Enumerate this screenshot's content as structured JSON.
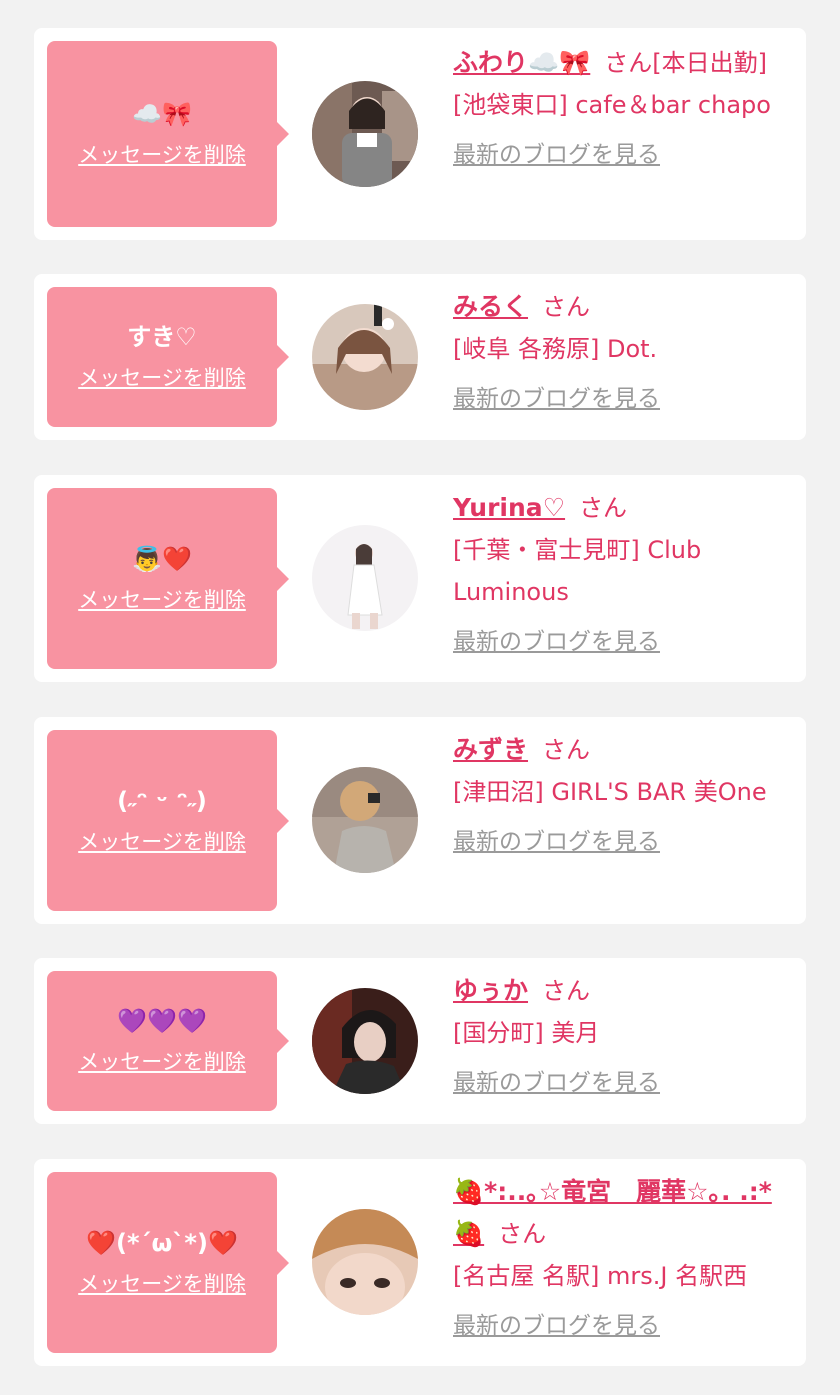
{
  "items": [
    {
      "message": "☁️🎀",
      "delete_label": "メッセージを削除",
      "name": "ふわり☁️🎀",
      "san": "さん",
      "status": "[本日出勤]",
      "shop": "[池袋東口] cafe＆bar chapo",
      "blog_label": "最新のブログを見る"
    },
    {
      "message": "すき♡",
      "delete_label": "メッセージを削除",
      "name": "みるく",
      "san": "さん",
      "shop": "[岐阜 各務原] Dot.",
      "blog_label": "最新のブログを見る"
    },
    {
      "message": "👼❤️",
      "delete_label": "メッセージを削除",
      "name": "Yurina♡",
      "san": "さん",
      "shop": "[千葉・富士見町] Club Luminous",
      "blog_label": "最新のブログを見る"
    },
    {
      "message": "(˶ᵔ ᵕ ᵔ˶)",
      "delete_label": "メッセージを削除",
      "name": "みずき",
      "san": "さん",
      "shop": "[津田沼] GIRL'S BAR 美One",
      "blog_label": "最新のブログを見る"
    },
    {
      "message": "💜💜💜",
      "delete_label": "メッセージを削除",
      "name": "ゆぅか",
      "san": "さん",
      "shop": "[国分町] 美月",
      "blog_label": "最新のブログを見る"
    },
    {
      "message": "❤️(*´ω`*)❤️",
      "delete_label": "メッセージを削除",
      "name": "🍓*:..｡☆竜宮　麗華☆｡. .:*🍓",
      "san": "さん",
      "shop": "[名古屋 名駅] mrs.J 名駅西",
      "blog_label": "最新のブログを見る"
    }
  ],
  "colors": {
    "bubble": "#f893a1",
    "accent": "#e03663",
    "muted": "#9a9a9a",
    "background": "#f2f2f2"
  }
}
